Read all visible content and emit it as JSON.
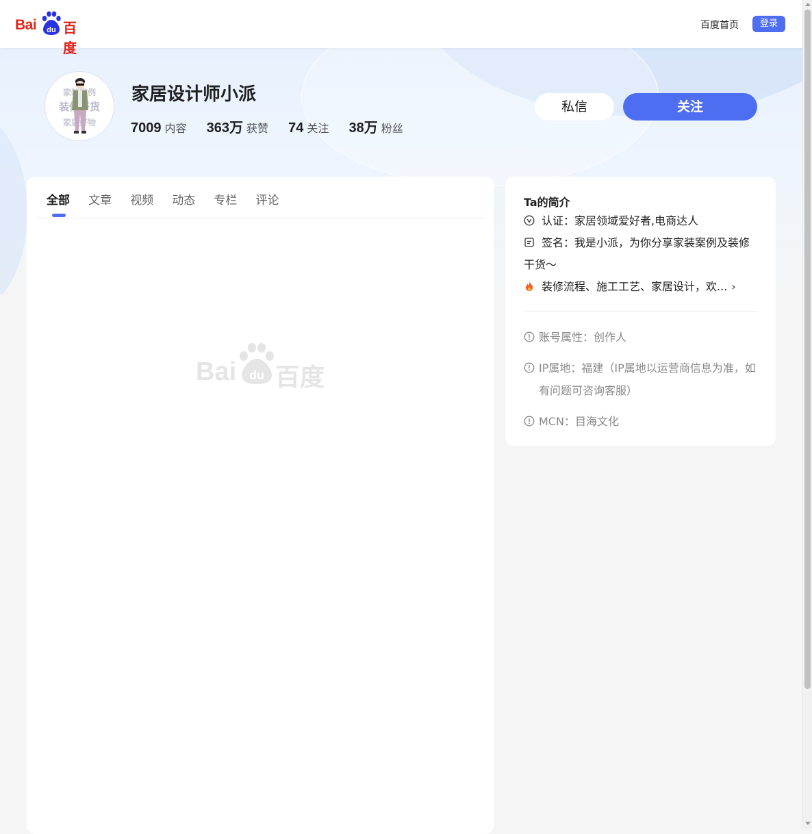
{
  "header": {
    "logo_bai": "Bai",
    "logo_du": "du",
    "logo_cn": "百度",
    "home_link": "百度首页",
    "login_label": "登录"
  },
  "profile": {
    "name": "家居设计师小派",
    "avatar_text": [
      "家装案例",
      "装修干货",
      "家居好物"
    ],
    "stats": [
      {
        "num": "7009",
        "label": "内容"
      },
      {
        "num": "363万",
        "label": "获赞"
      },
      {
        "num": "74",
        "label": "关注"
      },
      {
        "num": "38万",
        "label": "粉丝"
      }
    ],
    "message_label": "私信",
    "follow_label": "关注"
  },
  "tabs": [
    {
      "label": "全部",
      "active": true
    },
    {
      "label": "文章"
    },
    {
      "label": "视频"
    },
    {
      "label": "动态"
    },
    {
      "label": "专栏"
    },
    {
      "label": "评论"
    }
  ],
  "placeholder": {
    "bai": "Bai",
    "du": "du",
    "cn": "百度"
  },
  "intro": {
    "title": "Ta的简介",
    "certification": "认证：家居领域爱好者,电商达人",
    "signature": "签名：我是小派，为你分享家装案例及装修干货～",
    "topics": "装修流程、施工工艺、家居设计，欢...",
    "account_type": "账号属性：创作人",
    "ip_location": "IP属地：福建（IP属地以运营商信息为准，如有问题可咨询客服）",
    "mcn": "MCN：目海文化"
  },
  "colors": {
    "brand_red": "#e1251b",
    "brand_blue": "#2932e1",
    "accent": "#4e6ef2"
  }
}
